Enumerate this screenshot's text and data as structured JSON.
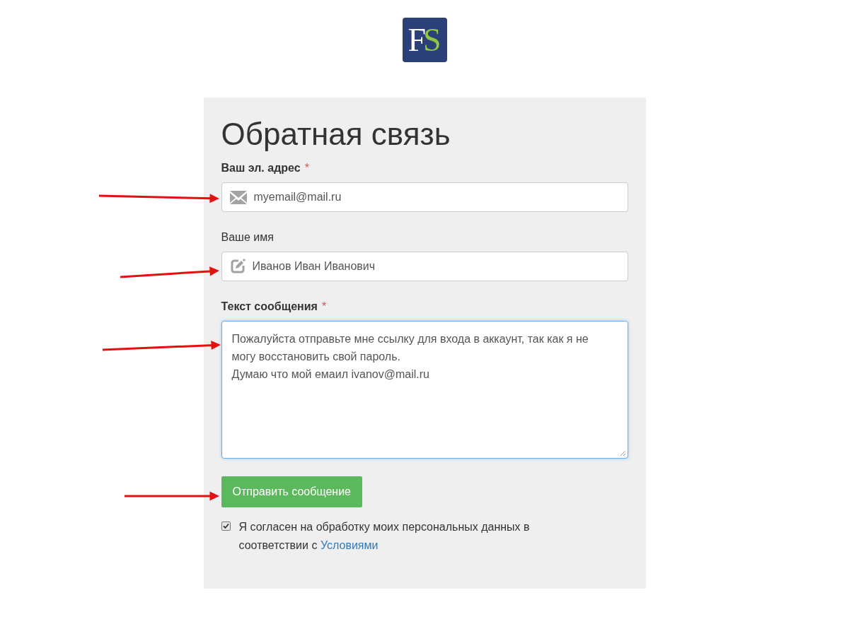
{
  "logo": {
    "text_1": "F",
    "text_2": "S"
  },
  "form": {
    "title": "Обратная связь",
    "fields": [
      {
        "kind": "input",
        "label": "Ваш эл. адрес",
        "required": true,
        "required_mark": "*",
        "value": "myemail@mail.ru",
        "focused": false
      },
      {
        "kind": "input",
        "label": "Ваше имя",
        "required": false,
        "value": "Иванов Иван Иванович",
        "focused": false
      },
      {
        "kind": "textarea",
        "label": "Текст сообщения",
        "required": true,
        "required_mark": "*",
        "value": "Пожалуйста отправьте мне ссылку для входа в аккаунт, так как я не могу восстановить свой пароль.\nДумаю что мой емаил ivanov@mail.ru",
        "focused": true
      }
    ],
    "submit": "Отправить сообщение",
    "consent": {
      "checked": true,
      "text": "Я согласен на обработку моих персональных данных в соответствии с",
      "link": "Условиями"
    }
  }
}
